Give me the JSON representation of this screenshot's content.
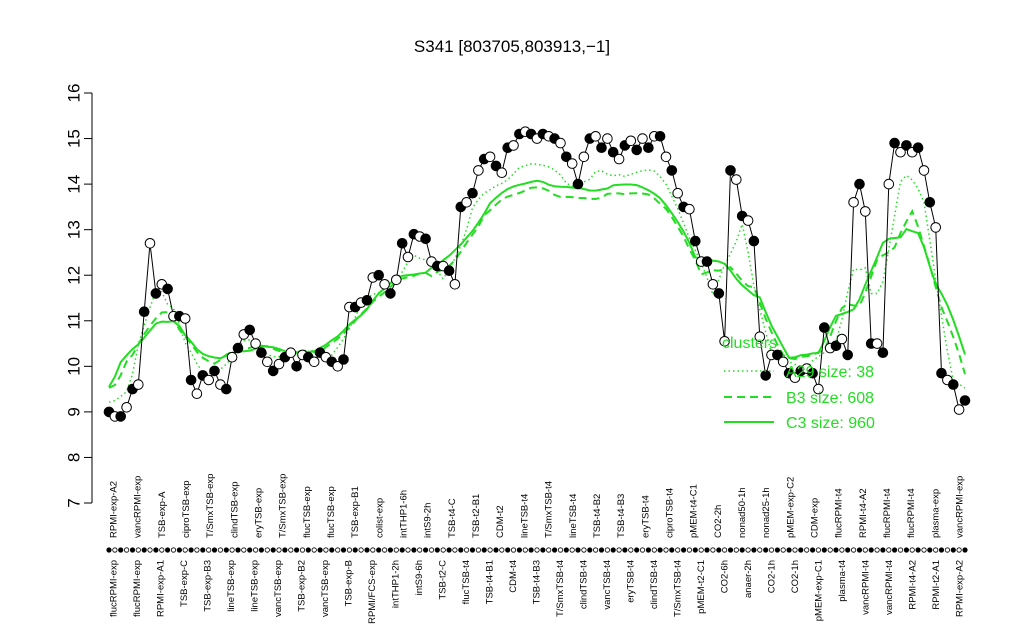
{
  "chart_data": {
    "type": "line",
    "title": "S341 [803705,803913,−1]",
    "ylim": [
      7,
      16
    ],
    "yticks": [
      7,
      8,
      9,
      10,
      11,
      12,
      13,
      14,
      15,
      16
    ],
    "grid": false,
    "legend": {
      "placement": "right",
      "title": "clusters",
      "entries": [
        {
          "label": "A29 size: 38",
          "style": "dotted"
        },
        {
          "label": "B3 size: 608",
          "style": "dashed"
        },
        {
          "label": "C3 size: 960",
          "style": "solid"
        }
      ]
    },
    "colors": {
      "series": "#000000",
      "cluster": "#22dd22"
    },
    "tick_labels_top": [
      "RPMI-exp-A2",
      "vancRPMI-exp",
      "TSB-exp-A",
      "ciproTSB-exp",
      "T/SmxTSB-exp",
      "clindTSB-exp",
      "eryTSB-exp",
      "T/SmxTSB-exp",
      "flucTSB-exp",
      "flucTSB-exp",
      "TSB-exp-B1",
      "colist-exp",
      "intTHP1-6h",
      "intS9-2h",
      "TSB-t4-C",
      "TSB-t2-B1",
      "CDM-t2",
      "lineTSB-t4",
      "T/SmxTSB-t4",
      "lineTSB-t4",
      "TSB-t4-B2",
      "TSB-t4-B3",
      "eryTSB-t4",
      "ciproTSB-t4",
      "pMEM-t4-C1",
      "CO2-2h",
      "nonad50-1h",
      "nonad25-1h",
      "pMEM-exp-C2",
      "CDM-exp",
      "flucRPMI-t4",
      "RPMI-t4-A2",
      "flucRPMI-t4",
      "flucRPMI-t4",
      "plasma-exp",
      "vancRPMI-exp"
    ],
    "tick_labels_bottom": [
      "flucRPMI-exp",
      "flucRPMI-exp",
      "RPMI-exp-A1",
      "TSB-exp-C",
      "TSB-exp-B3",
      "lineTSB-exp",
      "lineTSB-exp",
      "vancTSB-exp",
      "TSB-exp-B2",
      "vancTSB-exp",
      "TSB-exp-B",
      "RPMI/FCS-exp",
      "intTHP1-2h",
      "intS9-6h",
      "TSB-t2-C",
      "flucTSB-t4",
      "TSB-t4-B1",
      "CDM-t4",
      "TSB-t4-B3",
      "T/SmxTSB-t4",
      "clindTSB-t4",
      "vancTSB-t4",
      "eryTSB-t4",
      "clindTSB-t4",
      "T/SmxTSB-t4",
      "pMEM-t2-C1",
      "CO2-6h",
      "anaer-2h",
      "CO2-1h",
      "CO2-1h",
      "pMEM-exp-C1",
      "plasma-t4",
      "vancRPMI-t4",
      "vancRPMI-t4",
      "RPMI-t4-A2",
      "RPMI-t2-A1",
      "RPMI-exp-A2"
    ],
    "series": [
      {
        "values": [
          9.0,
          8.9,
          8.9,
          9.1,
          9.5,
          9.6,
          11.2,
          12.7,
          11.6,
          11.8,
          11.7,
          11.1,
          11.1,
          11.05,
          9.7,
          9.4,
          9.8,
          9.7,
          9.9,
          9.6,
          9.5,
          10.2,
          10.4,
          10.7,
          10.8,
          10.5,
          10.3,
          10.1,
          9.9,
          10.05,
          10.2,
          10.3,
          10.0,
          10.25,
          10.2,
          10.1,
          10.3,
          10.2,
          10.1,
          10.0,
          10.15,
          11.3,
          11.3,
          11.4,
          11.45,
          11.95,
          12.0,
          11.8,
          11.6,
          11.9,
          12.7,
          12.4,
          12.9,
          12.85,
          12.8,
          12.3,
          12.2,
          12.2,
          12.1,
          11.8,
          13.5,
          13.6,
          13.8,
          14.3,
          14.55,
          14.6,
          14.4,
          14.25,
          14.8,
          14.85,
          15.1,
          15.15,
          15.1,
          15.0,
          15.1,
          15.05,
          15.0,
          14.9,
          14.6,
          14.45,
          14.0,
          14.6,
          15.0,
          15.05,
          14.8,
          15.0,
          14.7,
          14.55,
          14.85,
          14.95,
          14.75,
          15.0,
          14.8,
          15.05,
          15.05,
          14.6,
          14.3,
          13.8,
          13.5,
          13.45,
          12.75,
          12.3,
          12.3,
          11.8,
          11.6,
          10.55,
          14.3,
          14.1,
          13.3,
          13.2,
          12.75,
          10.65,
          9.8,
          10.25,
          10.25,
          10.1,
          9.85,
          9.75,
          9.9,
          9.95,
          9.85,
          9.5,
          10.85,
          10.4,
          10.45,
          10.6,
          10.25,
          13.6,
          14.0,
          13.4,
          10.5,
          10.5,
          10.3,
          14.0,
          14.9,
          14.7,
          14.85,
          14.7,
          14.8,
          14.3,
          13.6,
          13.05,
          9.85,
          9.7,
          9.6,
          9.05,
          9.25
        ]
      }
    ]
  }
}
